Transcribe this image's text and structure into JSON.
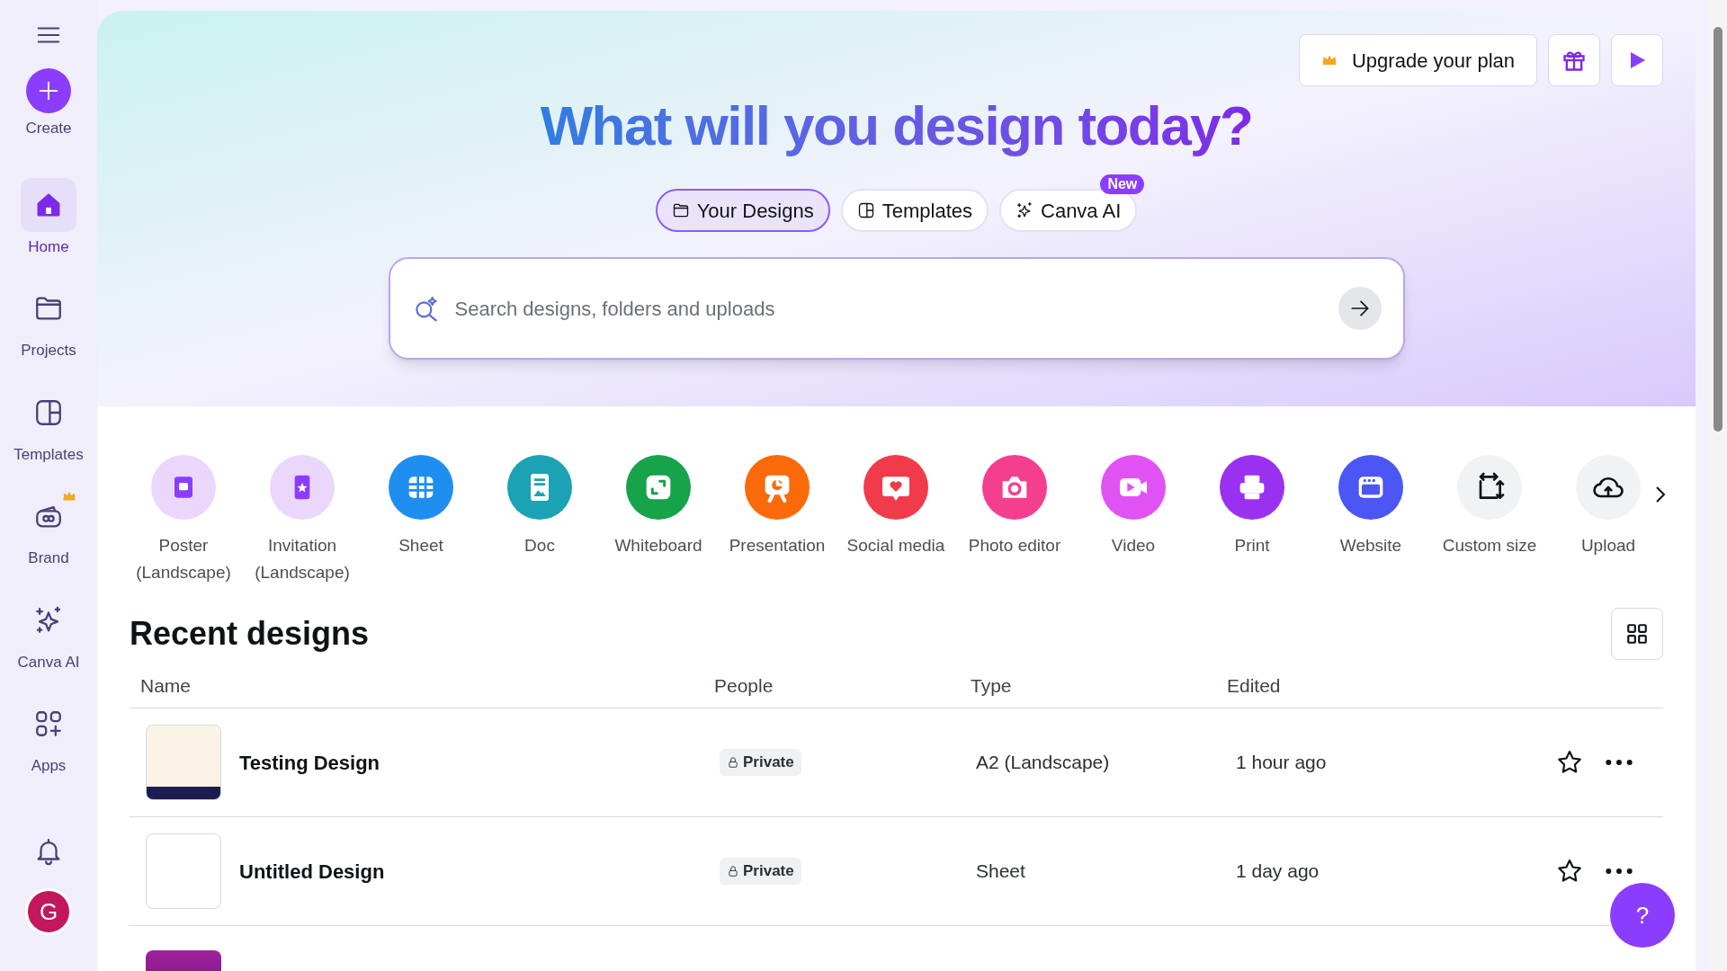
{
  "sidebar": {
    "items": [
      {
        "label": "Create",
        "kind": "create",
        "selected": false
      },
      {
        "label": "Home",
        "kind": "home",
        "selected": true
      },
      {
        "label": "Projects",
        "kind": "folder",
        "selected": false
      },
      {
        "label": "Templates",
        "kind": "templates",
        "selected": false
      },
      {
        "label": "Brand",
        "kind": "brand",
        "selected": false,
        "premium": true
      },
      {
        "label": "Canva AI",
        "kind": "sparkles",
        "selected": false
      },
      {
        "label": "Apps",
        "kind": "apps",
        "selected": false
      }
    ],
    "avatar": "G"
  },
  "header": {
    "upgrade_button": "Upgrade your plan"
  },
  "hero": {
    "title": "What will you design today?",
    "tabs": [
      {
        "label": "Your Designs",
        "kind": "folder",
        "selected": true
      },
      {
        "label": "Templates",
        "kind": "templates",
        "selected": false
      },
      {
        "label": "Canva AI",
        "kind": "sparkles",
        "selected": false,
        "badge": "New"
      }
    ],
    "search": {
      "placeholder": "Search designs, folders and uploads"
    }
  },
  "design_types": [
    {
      "label": "Poster\n(Landscape)",
      "kind": "poster",
      "color": "#ead7fb"
    },
    {
      "label": "Invitation\n(Landscape)",
      "kind": "invitation",
      "color": "#ead7fb"
    },
    {
      "label": "Sheet",
      "kind": "sheet",
      "color": "#1f8ef1"
    },
    {
      "label": "Doc",
      "kind": "doc",
      "color": "#1ba2b4"
    },
    {
      "label": "Whiteboard",
      "kind": "whiteboard",
      "color": "#16a34a"
    },
    {
      "label": "Presentation",
      "kind": "presentation",
      "color": "#fa6a0a"
    },
    {
      "label": "Social media",
      "kind": "social",
      "color": "#f13b4b"
    },
    {
      "label": "Photo editor",
      "kind": "camera",
      "color": "#f43f8e"
    },
    {
      "label": "Video",
      "kind": "video",
      "color": "#e152f5"
    },
    {
      "label": "Print",
      "kind": "print",
      "color": "#9b31f0"
    },
    {
      "label": "Website",
      "kind": "website",
      "color": "#4c56f5"
    },
    {
      "label": "Custom size",
      "kind": "resize",
      "color": "#f1f2f4"
    },
    {
      "label": "Upload",
      "kind": "upload",
      "color": "#f1f2f4"
    }
  ],
  "recent": {
    "title": "Recent designs",
    "columns": [
      "Name",
      "People",
      "Type",
      "Edited"
    ],
    "rows": [
      {
        "kind": "image",
        "name": "Testing Design",
        "people": "Private",
        "type": "A2 (Landscape)",
        "edited": "1 hour ago",
        "starred": false
      },
      {
        "kind": "blank",
        "name": "Untitled Design",
        "people": "Private",
        "type": "Sheet",
        "edited": "1 day ago",
        "starred": false
      },
      {
        "kind": "image-purple"
      }
    ]
  },
  "help_button": "?"
}
